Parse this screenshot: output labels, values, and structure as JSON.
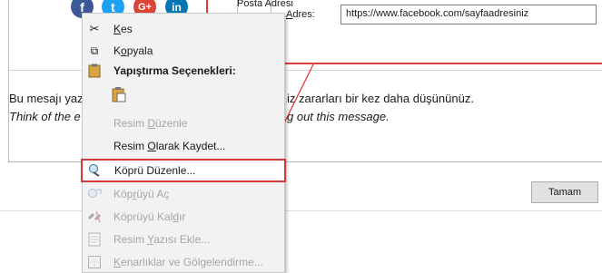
{
  "link_dialog": {
    "nav_item_label": "Posta Adresi",
    "address_label": "Adres:",
    "address_value": "https://www.facebook.com/sayfaadresiniz"
  },
  "social_icons": [
    {
      "name": "facebook-icon",
      "glyph": "f",
      "color": "#3b5998"
    },
    {
      "name": "twitter-icon",
      "glyph": "t",
      "color": "#1da1f2"
    },
    {
      "name": "google-plus-icon",
      "glyph": "G+",
      "color": "#db4437"
    },
    {
      "name": "linkedin-icon",
      "glyph": "in",
      "color": "#0077b5"
    }
  ],
  "body_text": {
    "line1_left": "Bu mesajı yaz",
    "line1_right": "iz zararları bir kez daha düşününüz.",
    "line2_left": "Think of the e",
    "line2_right": "g out this message."
  },
  "ok_button": "Tamam",
  "context_menu": {
    "items": [
      {
        "key": "cut",
        "pre": "",
        "u": "K",
        "post": "es",
        "icon": "scissors-icon",
        "glyph": "✂",
        "disabled": false
      },
      {
        "key": "copy",
        "pre": "K",
        "u": "o",
        "post": "pyala",
        "icon": "copy-icon",
        "glyph": "⧉",
        "disabled": false
      },
      {
        "key": "paste_header",
        "label": "Yapıştırma Seçenekleri:",
        "icon": "clipboard-icon",
        "glyph": "📋",
        "header": true
      },
      {
        "key": "paste_option",
        "label": "",
        "icon": "paste-keep-icon",
        "glyph": "📋",
        "disabled": false
      },
      {
        "key": "edit_picture",
        "pre": "Resim ",
        "u": "D",
        "post": "üzenle",
        "icon": "",
        "glyph": "",
        "disabled": true
      },
      {
        "key": "save_picture",
        "pre": "Resim ",
        "u": "O",
        "post": "larak Kaydet...",
        "icon": "",
        "glyph": "",
        "disabled": false
      },
      {
        "key": "edit_link",
        "pre": "Köprü Düzenle",
        "u": "",
        "post": "...",
        "icon": "link-edit-icon",
        "glyph": "🔗",
        "disabled": false
      },
      {
        "key": "open_link",
        "pre": "Köp",
        "u": "r",
        "post": "üyü Aç",
        "icon": "link-open-icon",
        "glyph": "🌐",
        "disabled": true
      },
      {
        "key": "remove_link",
        "pre": "Köprüyü Kal",
        "u": "d",
        "post": "ır",
        "icon": "link-remove-icon",
        "glyph": "⛓",
        "disabled": true
      },
      {
        "key": "insert_caption",
        "pre": "Resim ",
        "u": "Y",
        "post": "azısı Ekle...",
        "icon": "caption-icon",
        "glyph": "▤",
        "disabled": true
      },
      {
        "key": "borders_shading",
        "pre": "",
        "u": "K",
        "post": "enarlıklar ve Gölgelendirme...",
        "icon": "borders-icon",
        "glyph": "▢",
        "disabled": true
      }
    ]
  }
}
